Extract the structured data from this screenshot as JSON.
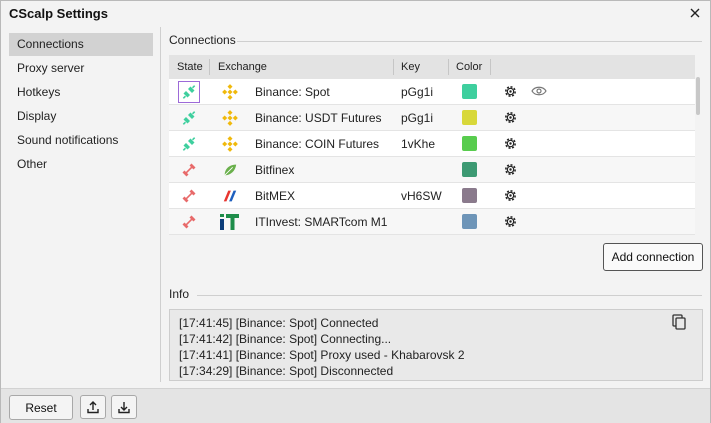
{
  "window": {
    "title": "CScalp Settings"
  },
  "sidebar": {
    "items": [
      {
        "label": "Connections",
        "active": true
      },
      {
        "label": "Proxy server"
      },
      {
        "label": "Hotkeys"
      },
      {
        "label": "Display"
      },
      {
        "label": "Sound notifications"
      },
      {
        "label": "Other"
      }
    ]
  },
  "connections": {
    "section_title": "Connections",
    "columns": {
      "state": "State",
      "exchange": "Exchange",
      "key": "Key",
      "color": "Color"
    },
    "rows": [
      {
        "state": "connected",
        "exchange": "Binance: Spot",
        "logo": "binance-logo",
        "key": "pGg1i",
        "color": "#3ecf9e",
        "show_eye": true
      },
      {
        "state": "connected",
        "exchange": "Binance: USDT Futures",
        "logo": "binance-logo",
        "key": "pGg1i",
        "color": "#d8d83a"
      },
      {
        "state": "connected",
        "exchange": "Binance: COIN Futures",
        "logo": "binance-logo",
        "key": "1vKhe",
        "color": "#58cc4e"
      },
      {
        "state": "disconnected",
        "exchange": "Bitfinex",
        "logo": "bitfinex-logo",
        "key": "",
        "color": "#3d9a73"
      },
      {
        "state": "disconnected",
        "exchange": "BitMEX",
        "logo": "bitmex-logo",
        "key": "vH6SW",
        "color": "#8a7a8c"
      },
      {
        "state": "disconnected",
        "exchange": "ITInvest: SMARTcom M1",
        "logo": "itinvest-logo",
        "key": "",
        "color": "#6e95b8"
      }
    ],
    "add_button": "Add connection"
  },
  "info": {
    "section_title": "Info",
    "lines": [
      "[17:41:45] [Binance: Spot] Connected",
      "[17:41:42] [Binance: Spot] Connecting...",
      "[17:41:41] [Binance: Spot] Proxy used - Khabarovsk 2",
      "[17:34:29] [Binance: Spot] Disconnected"
    ]
  },
  "footer": {
    "reset_label": "Reset",
    "upload_icon": "upload-icon",
    "download_icon": "download-icon"
  },
  "colors": {
    "connected": "#3ecf9e",
    "disconnected": "#e86a6a",
    "binance": "#f0b90b",
    "focus": "#9d6ad8"
  }
}
